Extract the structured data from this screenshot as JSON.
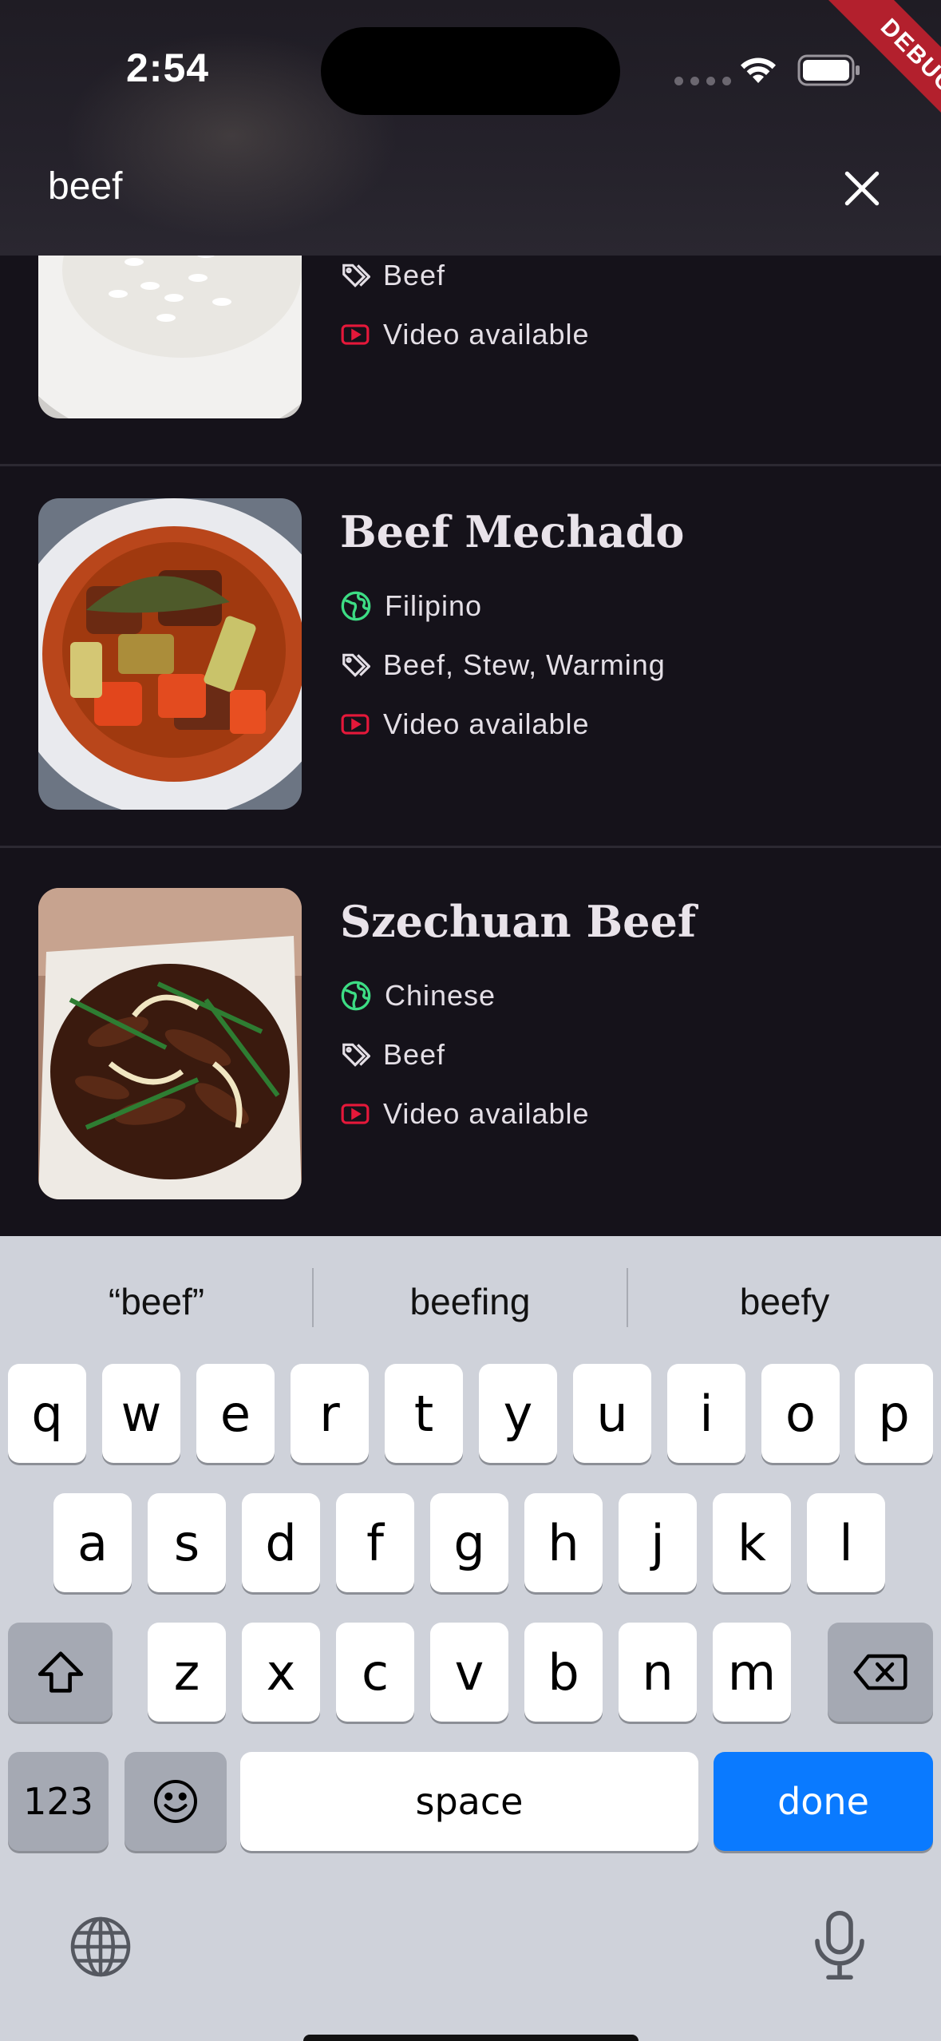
{
  "status_bar": {
    "time": "2:54",
    "debug_label": "DEBUG"
  },
  "search": {
    "query": "beef"
  },
  "recipes": [
    {
      "title": "",
      "area": "",
      "tags": "Beef",
      "video": "Video available"
    },
    {
      "title": "Beef Mechado",
      "area": "Filipino",
      "tags": "Beef, Stew, Warming",
      "video": "Video available"
    },
    {
      "title": "Szechuan Beef",
      "area": "Chinese",
      "tags": "Beef",
      "video": "Video available"
    }
  ],
  "colors": {
    "area_icon": "#3ddc84",
    "video_icon": "#e5183a",
    "keyboard_bg": "#cfd2da",
    "done_key": "#0a7aff"
  },
  "keyboard": {
    "suggestions": [
      "“beef”",
      "beefing",
      "beefy"
    ],
    "row1": [
      "q",
      "w",
      "e",
      "r",
      "t",
      "y",
      "u",
      "i",
      "o",
      "p"
    ],
    "row2": [
      "a",
      "s",
      "d",
      "f",
      "g",
      "h",
      "j",
      "k",
      "l"
    ],
    "row3": [
      "z",
      "x",
      "c",
      "v",
      "b",
      "n",
      "m"
    ],
    "numbers_label": "123",
    "space_label": "space",
    "done_label": "done"
  }
}
